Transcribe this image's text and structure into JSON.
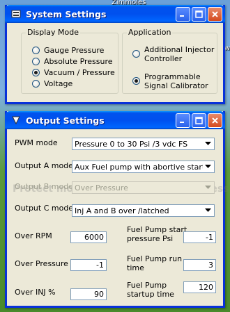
{
  "desktop": {
    "top_label": "Zimmoles",
    "edge_label": "ow"
  },
  "system_window": {
    "title": "System Settings",
    "display_mode": {
      "label": "Display Mode",
      "options": [
        "Gauge Pressure",
        "Absolute Pressure",
        "Vacuum / Pressure",
        "Voltage"
      ],
      "selected": "Vacuum / Pressure"
    },
    "application": {
      "label": "Application",
      "options": [
        {
          "line1": "Additional Injector",
          "line2": "Controller"
        },
        {
          "line1": "Programmable",
          "line2": "Signal Calibrator"
        }
      ],
      "selected": "Programmable Signal Calibrator"
    }
  },
  "output_window": {
    "title": "Output Settings",
    "watermark": "Protect more of your memories for less!",
    "pwm_mode": {
      "label": "PWM mode",
      "value": "Pressure 0 to 30 Psi /3 vdc FS"
    },
    "output_a": {
      "label": "Output A mode",
      "value": "Aux Fuel pump with abortive start time"
    },
    "output_b": {
      "label": "Output B mode",
      "value": "Over Pressure"
    },
    "output_c": {
      "label": "Output C mode",
      "value": "Inj A and B over /latched"
    },
    "over_rpm": {
      "label": "Over RPM",
      "value": "6000"
    },
    "over_pressure": {
      "label": "Over Pressure",
      "value": "-1"
    },
    "over_inj": {
      "label": "Over INJ %",
      "value": "90"
    },
    "fuel_start": {
      "line1": "Fuel Pump start",
      "line2": "pressure Psi",
      "value": "-1"
    },
    "fuel_run": {
      "line1": "Fuel Pump run",
      "line2": "time",
      "value": "3"
    },
    "fuel_startup": {
      "line1": "Fuel Pump",
      "line2": "startup time",
      "value": "120"
    }
  },
  "colors": {
    "titlebar": "#0054e3",
    "window_bg": "#ece9d8",
    "close_button": "#d44a1e"
  }
}
